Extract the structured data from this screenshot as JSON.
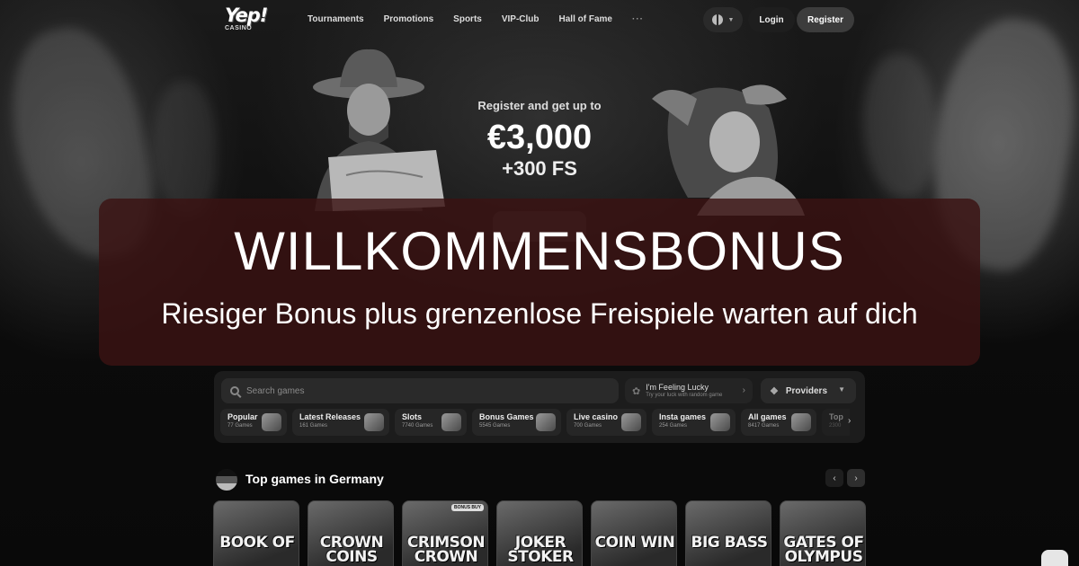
{
  "brand": {
    "logo_main": "Yep!",
    "logo_sub": "CASINO"
  },
  "nav": {
    "items": [
      "Tournaments",
      "Promotions",
      "Sports",
      "VIP-Club",
      "Hall of Fame"
    ],
    "more": "···"
  },
  "header": {
    "login_label": "Login",
    "register_label": "Register"
  },
  "hero": {
    "line1": "Register and get up to",
    "amount": "€3,000",
    "freespins": "+300 FS"
  },
  "overlay": {
    "title": "WILLKOMMENSBONUS",
    "subtitle": "Riesiger Bonus plus grenzenlose Freispiele warten auf dich"
  },
  "search": {
    "placeholder": "Search games"
  },
  "lucky": {
    "title": "I'm Feeling Lucky",
    "subtitle": "Try your luck with random game"
  },
  "providers": {
    "label": "Providers"
  },
  "categories": [
    {
      "name": "Popular",
      "count": "77 Games"
    },
    {
      "name": "Latest Releases",
      "count": "161 Games"
    },
    {
      "name": "Slots",
      "count": "7740 Games"
    },
    {
      "name": "Bonus Games",
      "count": "5545 Games"
    },
    {
      "name": "Live casino",
      "count": "700 Games"
    },
    {
      "name": "Insta games",
      "count": "254 Games"
    },
    {
      "name": "All games",
      "count": "8417 Games"
    },
    {
      "name": "Top",
      "count": "2300"
    }
  ],
  "top_games": {
    "title": "Top games in Germany",
    "games": [
      {
        "title": "BOOK OF",
        "badge": ""
      },
      {
        "title": "CROWN COINS",
        "badge": ""
      },
      {
        "title": "CRIMSON CROWN",
        "badge": "BONUS BUY"
      },
      {
        "title": "JOKER STOKER",
        "badge": ""
      },
      {
        "title": "COIN WIN",
        "badge": ""
      },
      {
        "title": "BIG BASS",
        "badge": ""
      },
      {
        "title": "GATES OF OLYMPUS",
        "badge": ""
      }
    ]
  },
  "icons": {
    "search": "search-icon",
    "globe": "globe-icon",
    "clover": "clover-icon",
    "providers": "providers-icon",
    "chevron": "chevron-right-icon",
    "chat": "chat-icon"
  }
}
